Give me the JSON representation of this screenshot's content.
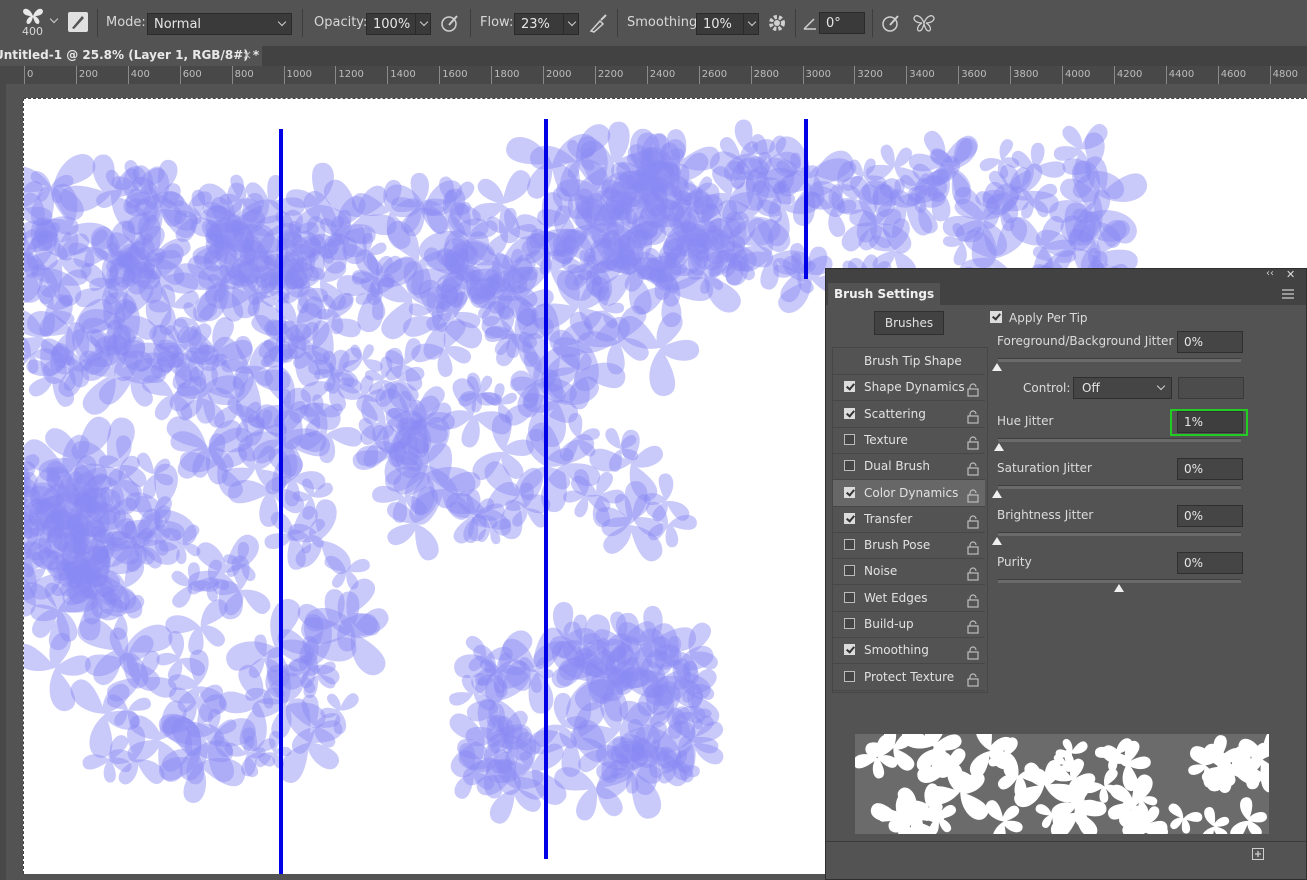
{
  "options_bar": {
    "brush_size": "400",
    "mode_label": "Mode:",
    "mode_value": "Normal",
    "opacity_label": "Opacity:",
    "opacity_value": "100%",
    "flow_label": "Flow:",
    "flow_value": "23%",
    "smoothing_label": "Smoothing:",
    "smoothing_value": "10%",
    "angle_value": "0°"
  },
  "document_tab": {
    "title": "Untitled-1 @ 25.8% (Layer 1, RGB/8#) *",
    "close": "×"
  },
  "ruler": {
    "ticks": [
      "0",
      "200",
      "400",
      "600",
      "800",
      "1000",
      "1200",
      "1400",
      "1600",
      "1800",
      "2000",
      "2200",
      "2400",
      "2600",
      "2800",
      "3000",
      "3200",
      "3400",
      "3600",
      "3800",
      "4000",
      "4200",
      "4400",
      "4600",
      "4800"
    ]
  },
  "brush_panel": {
    "title": "Brush Settings",
    "brushes_button": "Brushes",
    "items": [
      {
        "label": "Brush Tip Shape",
        "checkbox": false,
        "checked": false,
        "lock": false
      },
      {
        "label": "Shape Dynamics",
        "checkbox": true,
        "checked": true,
        "lock": true
      },
      {
        "label": "Scattering",
        "checkbox": true,
        "checked": true,
        "lock": true
      },
      {
        "label": "Texture",
        "checkbox": true,
        "checked": false,
        "lock": true
      },
      {
        "label": "Dual Brush",
        "checkbox": true,
        "checked": false,
        "lock": true
      },
      {
        "label": "Color Dynamics",
        "checkbox": true,
        "checked": true,
        "lock": true,
        "selected": true
      },
      {
        "label": "Transfer",
        "checkbox": true,
        "checked": true,
        "lock": true
      },
      {
        "label": "Brush Pose",
        "checkbox": true,
        "checked": false,
        "lock": true
      },
      {
        "label": "Noise",
        "checkbox": true,
        "checked": false,
        "lock": true
      },
      {
        "label": "Wet Edges",
        "checkbox": true,
        "checked": false,
        "lock": true
      },
      {
        "label": "Build-up",
        "checkbox": true,
        "checked": false,
        "lock": true
      },
      {
        "label": "Smoothing",
        "checkbox": true,
        "checked": true,
        "lock": true
      },
      {
        "label": "Protect Texture",
        "checkbox": true,
        "checked": false,
        "lock": true
      }
    ],
    "apply_per_tip": "Apply Per Tip",
    "fg_bg_jitter_label": "Foreground/Background Jitter",
    "fg_bg_jitter_value": "0%",
    "control_label": "Control:",
    "control_value": "Off",
    "hue_jitter_label": "Hue Jitter",
    "hue_jitter_value": "1%",
    "saturation_jitter_label": "Saturation Jitter",
    "saturation_jitter_value": "0%",
    "brightness_jitter_label": "Brightness Jitter",
    "brightness_jitter_value": "0%",
    "purity_label": "Purity",
    "purity_value": "0%",
    "highlight_color": "#22cc22"
  },
  "canvas": {
    "paint_color": "#0000e6",
    "tint_color": "#8a8af5"
  }
}
